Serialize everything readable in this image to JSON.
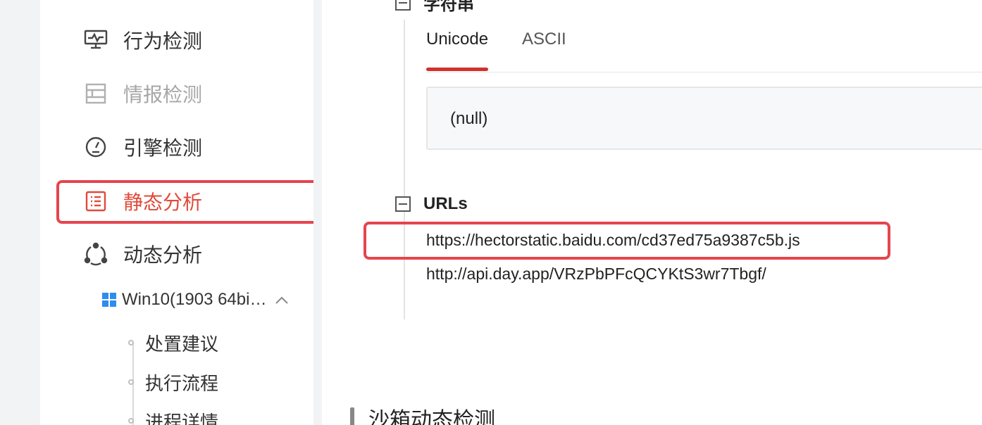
{
  "sidebar": {
    "items": [
      {
        "label": "行为检测",
        "icon": "monitor-icon",
        "state": "normal"
      },
      {
        "label": "情报检测",
        "icon": "layout-icon",
        "state": "disabled"
      },
      {
        "label": "引擎检测",
        "icon": "gauge-icon",
        "state": "normal"
      },
      {
        "label": "静态分析",
        "icon": "list-icon",
        "state": "active"
      },
      {
        "label": "动态分析",
        "icon": "share-nodes-icon",
        "state": "normal"
      }
    ],
    "environment": {
      "label": "Win10(1903 64bi…",
      "icon": "windows-icon",
      "expanded": true
    },
    "sub_items": [
      "处置建议",
      "执行流程",
      "进程详情"
    ]
  },
  "main": {
    "strings_section": {
      "title": "字符串",
      "tabs": [
        {
          "label": "Unicode",
          "active": true
        },
        {
          "label": "ASCII",
          "active": false
        }
      ],
      "value": "(null)"
    },
    "urls_section": {
      "title": "URLs",
      "items": [
        "https://hectorstatic.baidu.com/cd37ed75a9387c5b.js",
        "http://api.day.app/VRzPbPFcQCYKtS3wr7Tbgf/"
      ]
    },
    "sandbox_title": "沙箱动态检测"
  },
  "colors": {
    "accent": "#d0312d",
    "highlight_border": "#e5454e",
    "active_text": "#e04a3a",
    "windows_blue": "#2d8cf0"
  }
}
